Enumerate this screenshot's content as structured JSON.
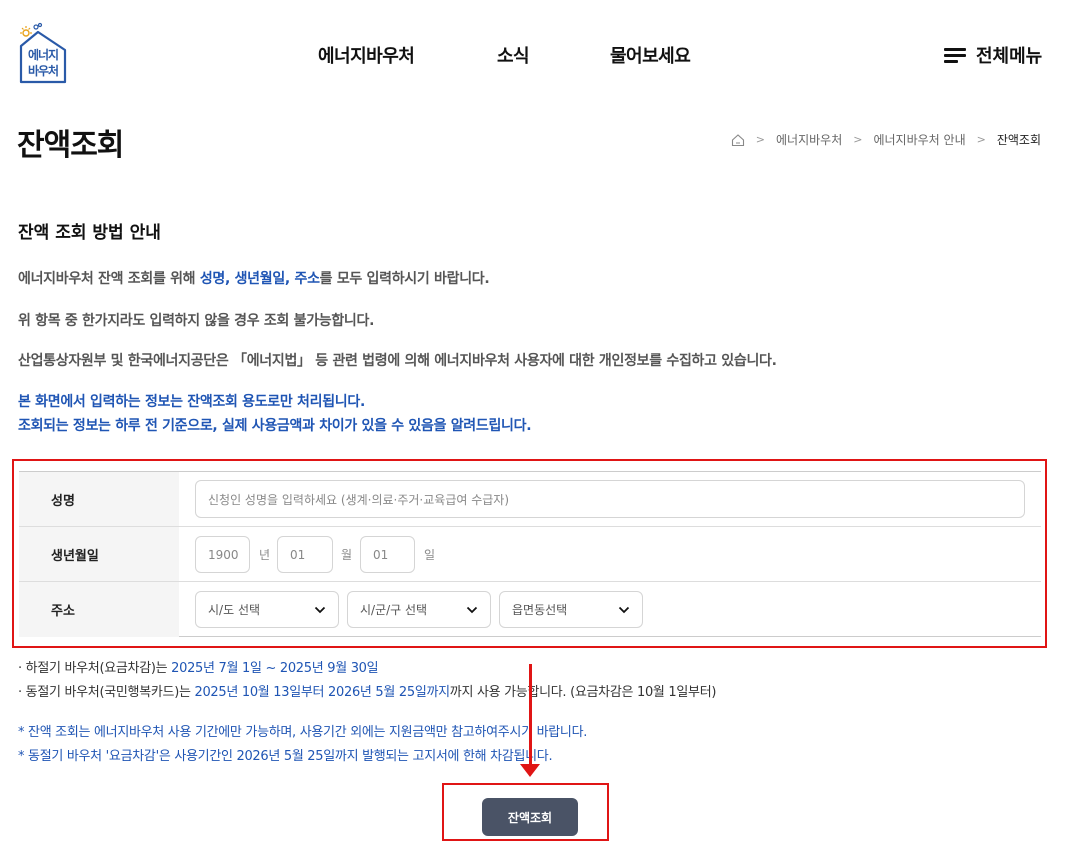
{
  "header": {
    "logo_text": [
      "에너지",
      "바우처"
    ],
    "nav": [
      "에너지바우처",
      "소식",
      "물어보세요"
    ],
    "all_menu": "전체메뉴"
  },
  "page": {
    "title": "잔액조회",
    "breadcrumb": [
      "에너지바우처",
      "에너지바우처 안내",
      "잔액조회"
    ]
  },
  "guide": {
    "title": "잔액 조회 방법 안내",
    "p1_pre": "에너지바우처 잔액 조회를 위해 ",
    "p1_highlight": "성명, 생년월일, 주소",
    "p1_post": "를 모두 입력하시기 바랍니다.",
    "p2": "위 항목 중 한가지라도 입력하지 않을 경우 조회 불가능합니다.",
    "p3": "산업통상자원부 및 한국에너지공단은 「에너지법」 등 관련 법령에 의해 에너지바우처 사용자에 대한 개인정보를 수집하고 있습니다.",
    "p4": "본 화면에서 입력하는 정보는 잔액조회 용도로만 처리됩니다.",
    "p5": "조회되는 정보는 하루 전 기준으로, 실제 사용금액과 차이가 있을 수 있음을 알려드립니다."
  },
  "form": {
    "name_label": "성명",
    "name_placeholder": "신청인 성명을 입력하세요 (생계·의료·주거·교육급여 수급자)",
    "birth_label": "생년월일",
    "year_placeholder": "1900",
    "year_unit": "년",
    "month_placeholder": "01",
    "month_unit": "월",
    "day_placeholder": "01",
    "day_unit": "일",
    "address_label": "주소",
    "sido": "시/도 선택",
    "sigungu": "시/군/구 선택",
    "eupmyeondong": "읍면동선택"
  },
  "notes": {
    "n1_pre": "· 하절기 바우처(요금차감)는 ",
    "n1_highlight": "2025년 7월 1일 ~ 2025년 9월 30일",
    "n2_pre": "· 동절기 바우처(국민행복카드)는 ",
    "n2_highlight": "2025년 10월 13일부터 2026년 5월 25일까지",
    "n2_post": "까지 사용 가능합니다. (요금차감은 10월 1일부터)",
    "n3": "* 잔액 조회는 에너지바우처 사용 기간에만 가능하며, 사용기간 외에는 지원금액만 참고하여주시기 바랍니다.",
    "n4": "* 동절기 바우처 '요금차감'은 사용기간인 2026년 5월 25일까지 발행되는 고지서에 한해 차감됩니다."
  },
  "submit_label": "잔액조회",
  "colors": {
    "highlight": "#e01515",
    "accent": "#1f55b4",
    "button": "#4a5366"
  }
}
